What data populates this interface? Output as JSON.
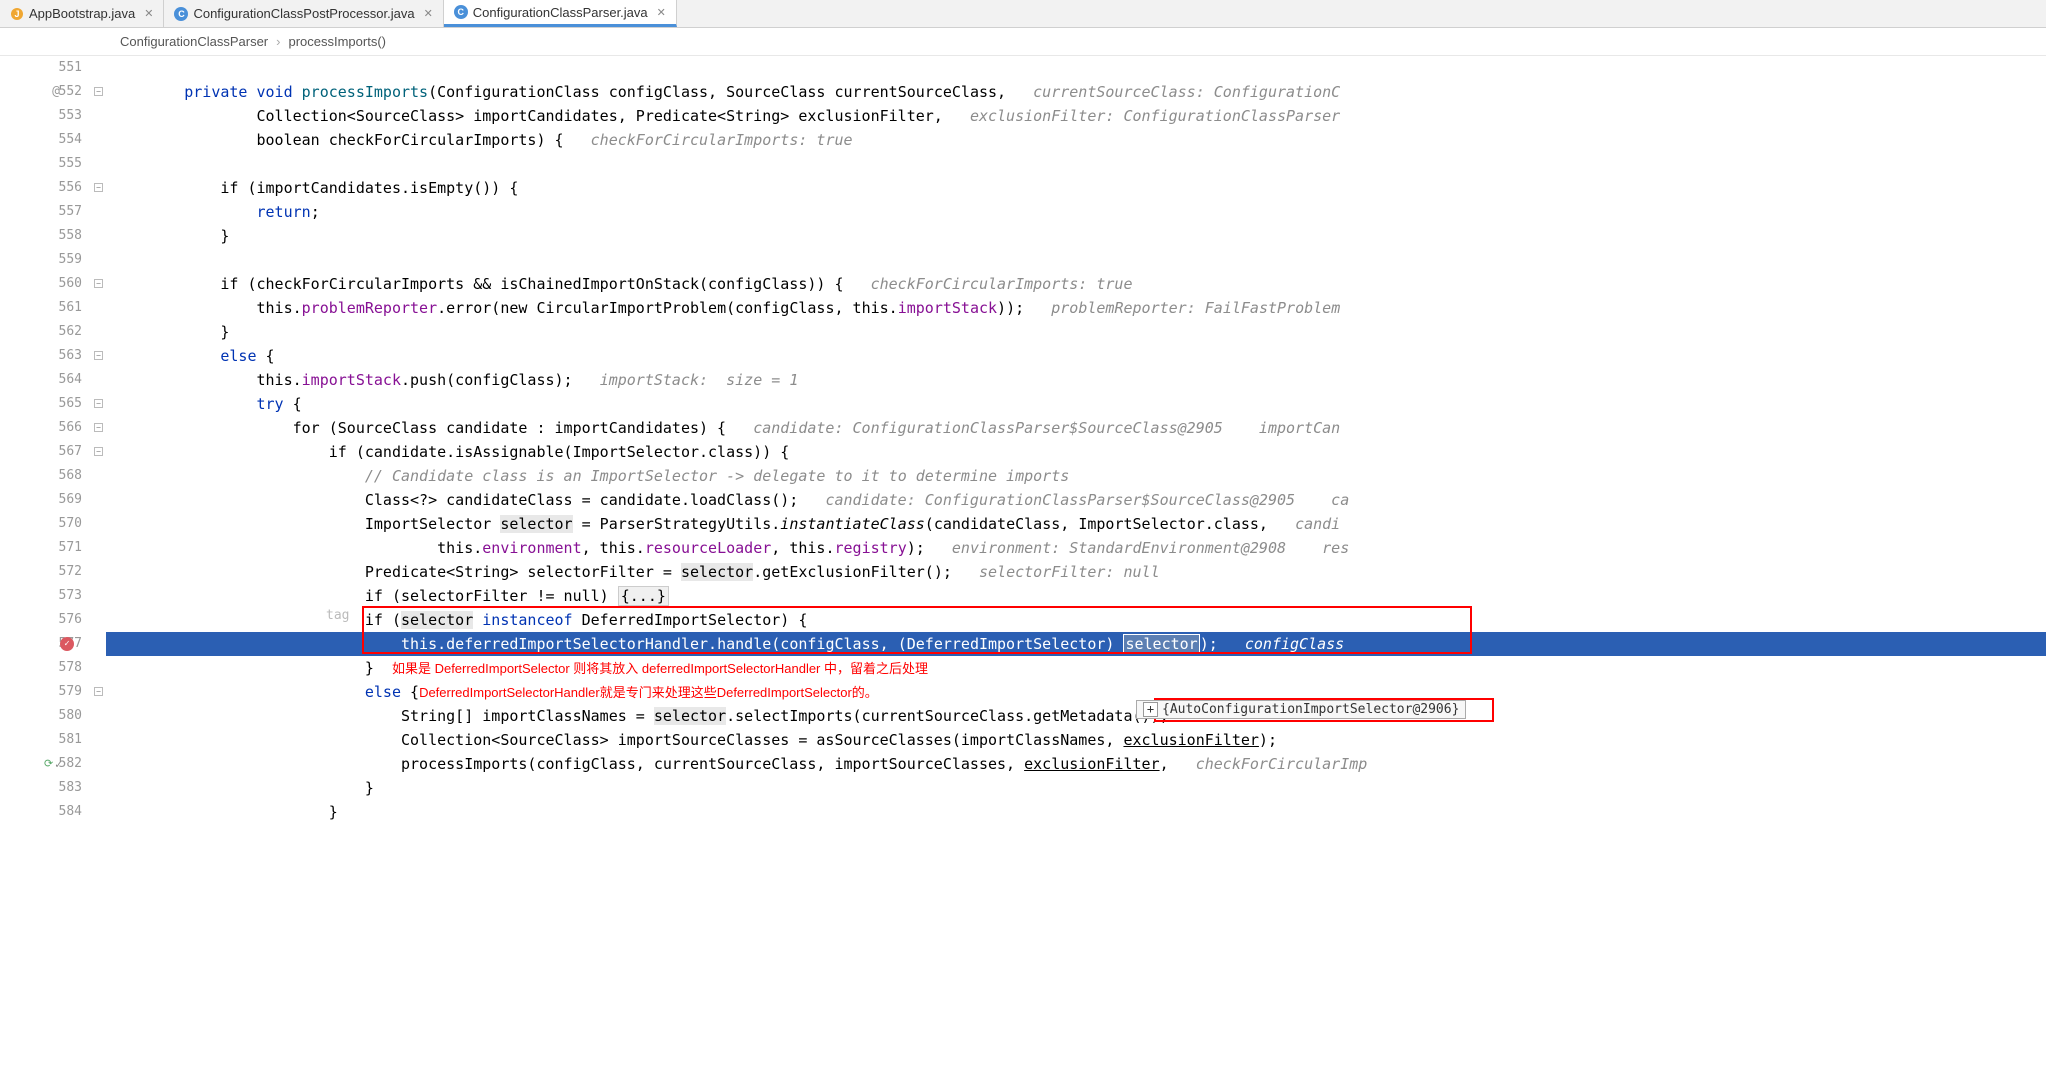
{
  "tabs": [
    {
      "label": "AppBootstrap.java",
      "icon": "java",
      "active": false
    },
    {
      "label": "ConfigurationClassPostProcessor.java",
      "icon": "class",
      "active": false
    },
    {
      "label": "ConfigurationClassParser.java",
      "icon": "class",
      "active": true
    }
  ],
  "breadcrumb": {
    "class": "ConfigurationClassParser",
    "method": "processImports()"
  },
  "gutter": {
    "lines": [
      "551",
      "552",
      "553",
      "554",
      "555",
      "556",
      "557",
      "558",
      "559",
      "560",
      "561",
      "562",
      "563",
      "564",
      "565",
      "566",
      "567",
      "568",
      "569",
      "570",
      "571",
      "572",
      "573",
      "576",
      "577",
      "578",
      "579",
      "580",
      "581",
      "582",
      "583",
      "584"
    ],
    "anno552": "@",
    "breakpointLine": "577",
    "runLine": "582"
  },
  "code": {
    "l552a": "        private void ",
    "l552b": "processImports",
    "l552c": "(ConfigurationClass configClass, SourceClass currentSourceClass,   ",
    "l552d": "currentSourceClass: ConfigurationC",
    "l553a": "                Collection<SourceClass> importCandidates, Predicate<String> exclusionFilter,   ",
    "l553b": "exclusionFilter: ConfigurationClassParser",
    "l554a": "                boolean checkForCircularImports) {   ",
    "l554b": "checkForCircularImports: true",
    "l556": "            if (importCandidates.isEmpty()) {",
    "l557a": "                ",
    "l557b": "return",
    "l557c": ";",
    "l558": "            }",
    "l560a": "            if (checkForCircularImports && isChainedImportOnStack(configClass)) {   ",
    "l560b": "checkForCircularImports: true",
    "l561a": "                this.",
    "l561b": "problemReporter",
    "l561c": ".error(new CircularImportProblem(configClass, this.",
    "l561d": "importStack",
    "l561e": "));   ",
    "l561f": "problemReporter: FailFastProblem",
    "l562": "            }",
    "l563a": "            ",
    "l563b": "else",
    "l563c": " {",
    "l564a": "                this.",
    "l564b": "importStack",
    "l564c": ".push(configClass);   ",
    "l564d": "importStack:  size = 1",
    "l565a": "                ",
    "l565b": "try",
    "l565c": " {",
    "l566a": "                    for (SourceClass candidate : importCandidates) {   ",
    "l566b": "candidate: ConfigurationClassParser$SourceClass@2905    importCan",
    "l567a": "                        if (candidate.isAssignable(ImportSelector.class)) {",
    "l568a": "                            ",
    "l568b": "// Candidate class is an ImportSelector -> delegate to it to determine imports",
    "l569a": "                            Class<?> candidateClass = candidate.loadClass();   ",
    "l569b": "candidate: ConfigurationClassParser$SourceClass@2905    ca",
    "l570a": "                            ImportSelector ",
    "l570b": "selector",
    "l570c": " = ParserStrategyUtils.",
    "l570d": "instantiateClass",
    "l570e": "(candidateClass, ImportSelector.class,   ",
    "l570f": "candi",
    "l571a": "                                    this.",
    "l571b": "environment",
    "l571c": ", this.",
    "l571d": "resourceLoader",
    "l571e": ", this.",
    "l571f": "registry",
    "l571g": ");   ",
    "l571h": "environment: StandardEnvironment@2908    res",
    "l572a": "                            Predicate<String> selectorFilter = ",
    "l572b": "selector",
    "l572c": ".getExclusionFilter();   ",
    "l572d": "selectorFilter: null",
    "l573a": "                            if (selectorFilter != null) ",
    "l573b": "{...}",
    "l576tag": "tag",
    "l576a": "                            if (",
    "l576b": "selector",
    "l576c": " instanceof DeferredImportSelector) {",
    "l577a": "                                this.",
    "l577b": "deferredImportSelectorHandler",
    "l577c": ".handle(configClass, (DeferredImportSelector) ",
    "l577d": "selector",
    "l577e": ");   ",
    "l577f": "configClass",
    "l578a": "                            }",
    "l578note": "     如果是 DeferredImportSelector 则将其放入 deferredImportSelectorHandler 中，留着之后处理",
    "l579a": "                            ",
    "l579b": "else",
    "l579c": " {",
    "l579note": "DeferredImportSelectorHandler就是专门来处理这些DeferredImportSelector的。",
    "l580a": "                                String[] importClassNames = ",
    "l580b": "selector",
    "l580c": ".selectImports(currentSourceClass.getMetadata());",
    "l581a": "                                Collection<SourceClass> importSourceClasses = asSourceClasses(importClassNames, ",
    "l581b": "exclusionFilter",
    "l581c": ");",
    "l582a": "                                processImports(configClass, currentSourceClass, importSourceClasses, ",
    "l582b": "exclusionFilter",
    "l582c": ",   ",
    "l582d": "checkForCircularImp",
    "l583": "                            }",
    "l584": "                        }"
  },
  "tooltip": {
    "text": "{AutoConfigurationImportSelector@2906}"
  }
}
